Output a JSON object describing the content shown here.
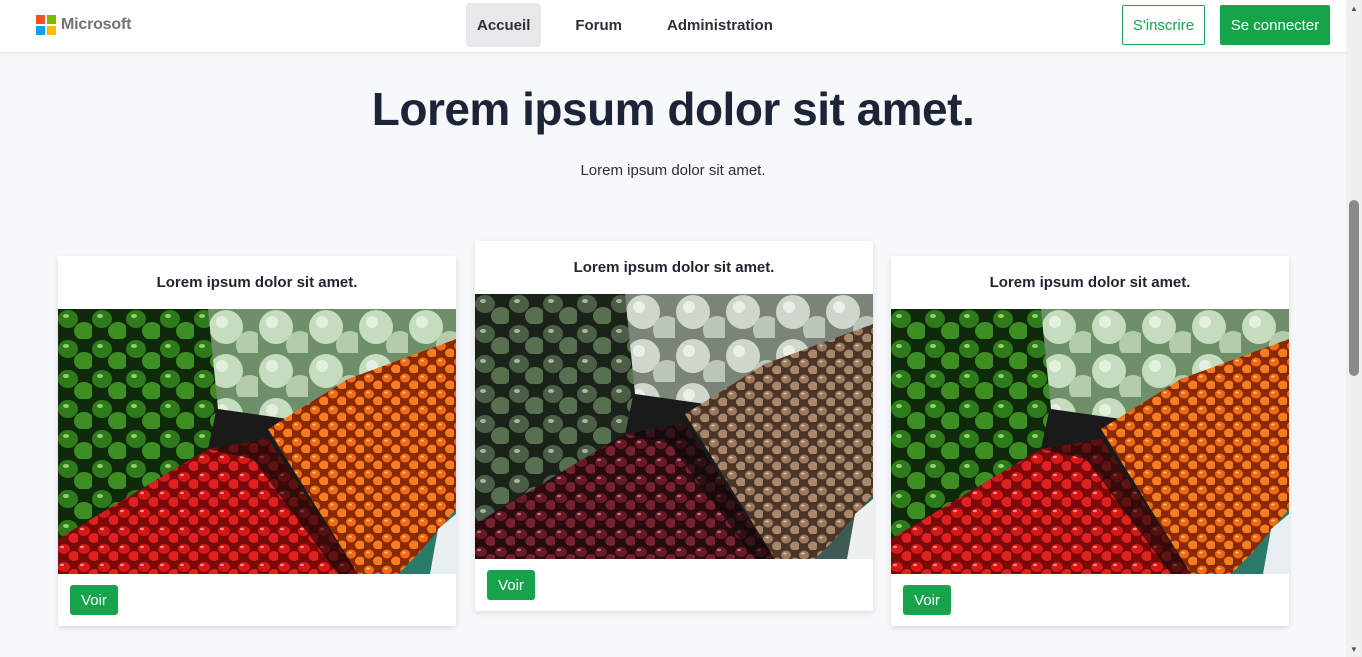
{
  "brand": {
    "name": "Microsoft",
    "logo_colors": [
      "#f25022",
      "#7fba00",
      "#00a4ef",
      "#ffb900"
    ]
  },
  "nav": {
    "items": [
      {
        "label": "Accueil",
        "active": true
      },
      {
        "label": "Forum",
        "active": false
      },
      {
        "label": "Administration",
        "active": false
      }
    ]
  },
  "auth": {
    "signup_label": "S'inscrire",
    "login_label": "Se connecter"
  },
  "hero": {
    "title": "Lorem ipsum dolor sit amet.",
    "subtitle": "Lorem ipsum dolor sit amet."
  },
  "cards": [
    {
      "title": "Lorem ipsum dolor sit amet.",
      "button": "Voir",
      "image": "vegetable-market-photo"
    },
    {
      "title": "Lorem ipsum dolor sit amet.",
      "button": "Voir",
      "image": "vegetable-market-photo"
    },
    {
      "title": "Lorem ipsum dolor sit amet.",
      "button": "Voir",
      "image": "vegetable-market-photo"
    }
  ],
  "colors": {
    "accent": "#16a34a",
    "page_bg": "#f7f8fa",
    "heading": "#1b2537"
  }
}
